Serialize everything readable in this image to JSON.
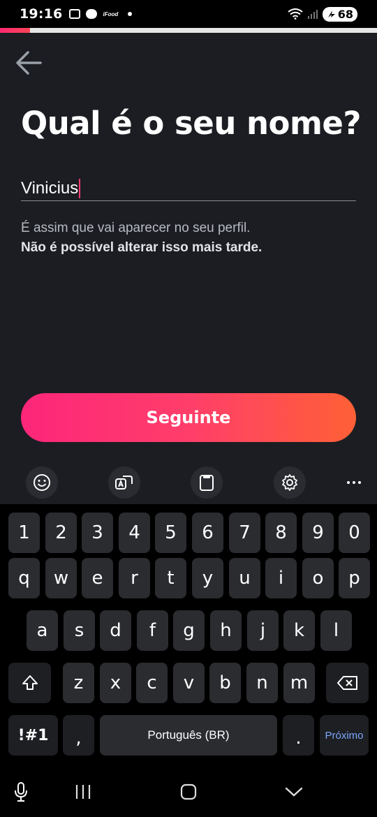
{
  "status_bar": {
    "time": "19:16",
    "notification_label": "iFood",
    "battery": "68"
  },
  "progress": {
    "value_percent": 8,
    "color": "#fd2a70"
  },
  "screen": {
    "title": "Qual é o seu nome?",
    "name_input": {
      "value": "Vinicius",
      "placeholder": ""
    },
    "hint_line1": "É assim que vai aparecer no seu perfil.",
    "hint_line2": "Não é possível alterar isso mais tarde.",
    "continue_label": "Seguinte",
    "accent_color": "#fe3c72"
  },
  "keyboard": {
    "toolbar_icons": [
      "emoji-icon",
      "translate-icon",
      "clipboard-icon",
      "settings-icon",
      "more-icon"
    ],
    "number_row": [
      "1",
      "2",
      "3",
      "4",
      "5",
      "6",
      "7",
      "8",
      "9",
      "0"
    ],
    "row1": [
      "q",
      "w",
      "e",
      "r",
      "t",
      "y",
      "u",
      "i",
      "o",
      "p"
    ],
    "row2": [
      "a",
      "s",
      "d",
      "f",
      "g",
      "h",
      "j",
      "k",
      "l"
    ],
    "row3": [
      "z",
      "x",
      "c",
      "v",
      "b",
      "n",
      "m"
    ],
    "symbols_label": "!#1",
    "comma_label": ",",
    "space_label": "Português (BR)",
    "period_label": ".",
    "action_label": "Próximo"
  },
  "navbar": {
    "icons": [
      "voice-input-icon",
      "recents-icon",
      "home-icon",
      "hide-keyboard-icon"
    ]
  }
}
